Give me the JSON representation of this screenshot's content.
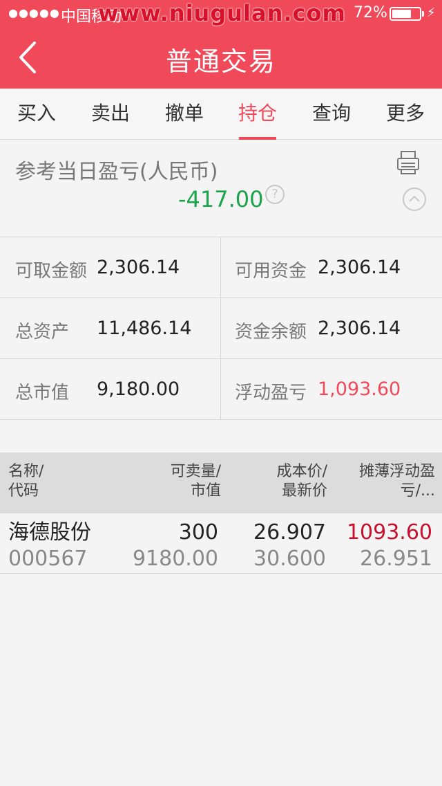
{
  "status_bar": {
    "signal": "●●●●●",
    "carrier": "中国移动",
    "watermark": "www.niugulan.com",
    "battery_pct": "72%",
    "battery_level": 0.72
  },
  "header": {
    "title": "普通交易"
  },
  "tabs": [
    {
      "label": "买入"
    },
    {
      "label": "卖出"
    },
    {
      "label": "撤单"
    },
    {
      "label": "持仓"
    },
    {
      "label": "查询"
    },
    {
      "label": "更多"
    }
  ],
  "active_tab": "持仓",
  "summary": {
    "label": "参考当日盈亏(人民币)",
    "value": "-417.00",
    "help": "?"
  },
  "account": {
    "withdrawable_label": "可取金额",
    "withdrawable_value": "2,306.14",
    "available_label": "可用资金",
    "available_value": "2,306.14",
    "total_assets_label": "总资产",
    "total_assets_value": "11,486.14",
    "balance_label": "资金余额",
    "balance_value": "2,306.14",
    "market_value_label": "总市值",
    "market_value_value": "9,180.00",
    "floating_pl_label": "浮动盈亏",
    "floating_pl_value": "1,093.60"
  },
  "holdings": {
    "headers": {
      "name_1": "名称/",
      "name_2": "代码",
      "qty_1": "可卖量/",
      "qty_2": "市值",
      "cost_1": "成本价/",
      "cost_2": "最新价",
      "pl_1": "摊薄浮动盈",
      "pl_2": "亏/..."
    },
    "rows": [
      {
        "name": "海德股份",
        "code": "000567",
        "qty": "300",
        "market_value": "9180.00",
        "cost": "26.907",
        "latest": "30.600",
        "pl": "1093.60",
        "pl_2": "26.951"
      }
    ]
  },
  "colors": {
    "brand": "#f04a5a",
    "loss": "#1aa34a",
    "gain": "#c8102e"
  }
}
